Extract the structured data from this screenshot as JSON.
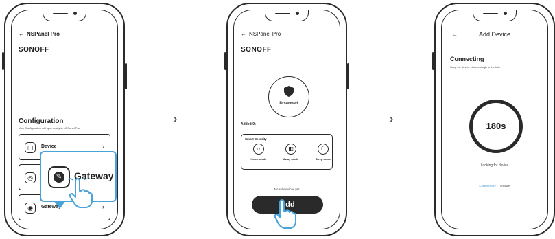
{
  "colors": {
    "accent": "#4aa3d8",
    "ink": "#2a2a2a"
  },
  "navigation": {
    "next_glyph": "›"
  },
  "screen1": {
    "back_icon": "arrow-left-icon",
    "app_title": "NSPanel Pro",
    "brand": "SONOFF",
    "section_title": "Configuration",
    "section_subtitle": "Your Configuration will sync easily to NSPanel Pro",
    "menu": [
      {
        "label": "Device",
        "icon": "device-icon"
      },
      {
        "label": "",
        "icon": "hub-icon"
      },
      {
        "label": "Gateway",
        "icon": "gateway-icon"
      }
    ],
    "callout_label": "Gateway"
  },
  "screen2": {
    "app_title": "NSPanel Pro",
    "brand": "SONOFF",
    "status_label": "Disarmed",
    "subtitle": "Added(0)",
    "security_title": "Smart Security",
    "modes": [
      {
        "label": "Home mode",
        "icon": "home-icon"
      },
      {
        "label": "Away mode",
        "icon": "away-icon"
      },
      {
        "label": "Sleep mode",
        "icon": "sleep-icon"
      }
    ],
    "hint": "No subdevices yet",
    "add_label": "Add"
  },
  "screen3": {
    "title": "Add Device",
    "heading": "Connecting",
    "description": "Keep the device close enough to the hub.",
    "timer": "180s",
    "status": "Looking for device",
    "link_primary": "Extensions",
    "link_secondary": "Paired"
  }
}
